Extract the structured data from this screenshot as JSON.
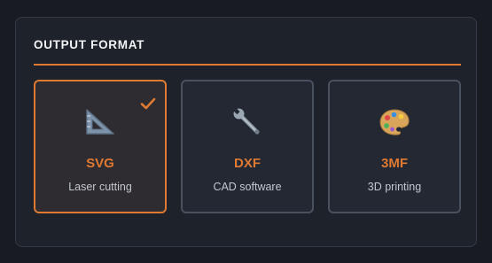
{
  "output_format": {
    "title": "OUTPUT FORMAT",
    "accent_color": "#e07a33",
    "selected": "SVG",
    "options": [
      {
        "name": "SVG",
        "description": "Laser cutting",
        "icon": "triangular-ruler-icon",
        "selected": true
      },
      {
        "name": "DXF",
        "description": "CAD software",
        "icon": "wrench-icon",
        "selected": false
      },
      {
        "name": "3MF",
        "description": "3D printing",
        "icon": "artist-palette-icon",
        "selected": false
      }
    ]
  }
}
